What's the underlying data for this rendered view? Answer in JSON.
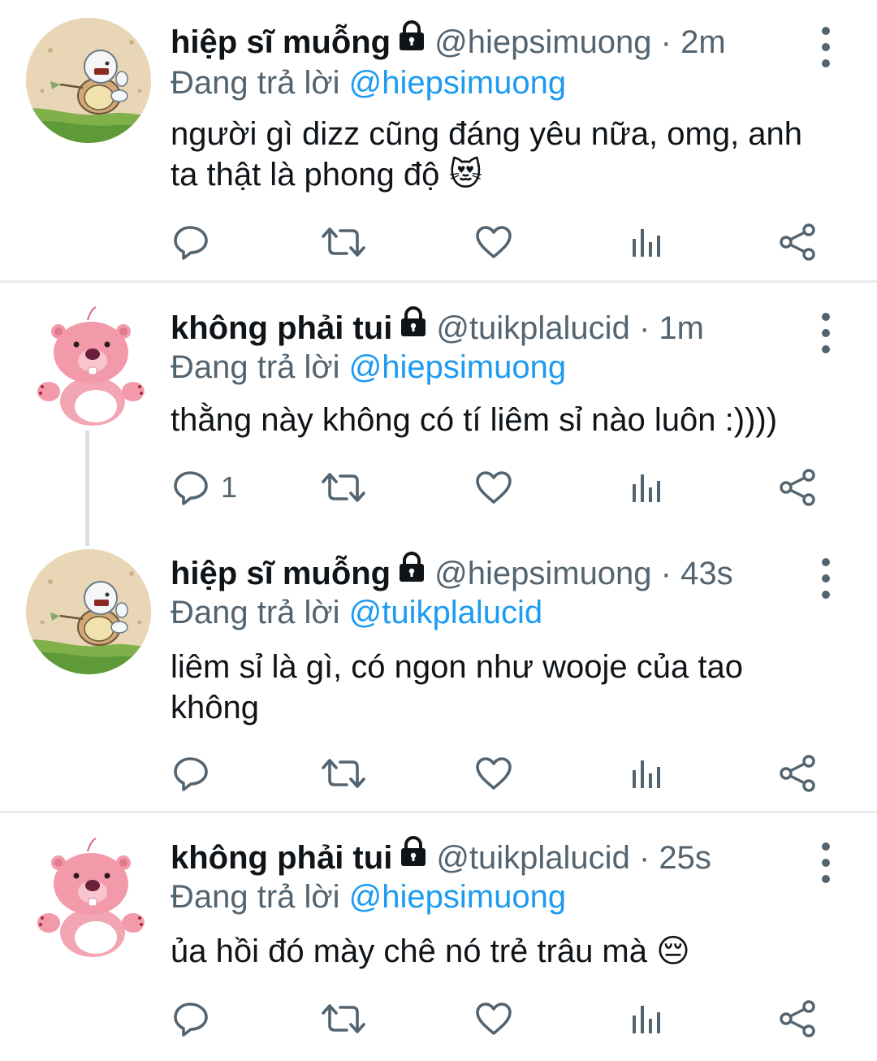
{
  "tweets": [
    {
      "name": "hiệp sĩ muỗng",
      "handle": "@hiepsimuong",
      "separator": "·",
      "time": "2m",
      "reply_prefix": "Đang trả lời",
      "reply_to": "@hiepsimuong",
      "text": "người gì dizz cũng đáng yêu nữa, omg, anh ta thật là phong độ 😻",
      "reply_count": "",
      "avatar": "squirtle-avatar"
    },
    {
      "name": "không phải tui",
      "handle": "@tuikplalucid",
      "separator": "·",
      "time": "1m",
      "reply_prefix": "Đang trả lời",
      "reply_to": "@hiepsimuong",
      "text": "thằng này không có tí liêm sỉ nào luôn :))))",
      "reply_count": "1",
      "avatar": "pink-beaver-avatar"
    },
    {
      "name": "hiệp sĩ muỗng",
      "handle": "@hiepsimuong",
      "separator": "·",
      "time": "43s",
      "reply_prefix": "Đang trả lời",
      "reply_to": "@tuikplalucid",
      "text": "liêm sỉ là gì, có ngon như wooje của tao không",
      "reply_count": "",
      "avatar": "squirtle-avatar"
    },
    {
      "name": "không phải tui",
      "handle": "@tuikplalucid",
      "separator": "·",
      "time": "25s",
      "reply_prefix": "Đang trả lời",
      "reply_to": "@hiepsimuong",
      "text": "ủa hồi đó mày chê nó trẻ trâu mà 😔",
      "reply_count": "",
      "avatar": "pink-beaver-avatar"
    }
  ],
  "icons": [
    "reply-icon",
    "retweet-icon",
    "like-icon",
    "analytics-icon",
    "share-icon",
    "lock-icon",
    "more-icon"
  ],
  "colors": {
    "text": "#0f1419",
    "secondary": "#536471",
    "link": "#1d9bf0",
    "divider": "#e6ecf0"
  }
}
